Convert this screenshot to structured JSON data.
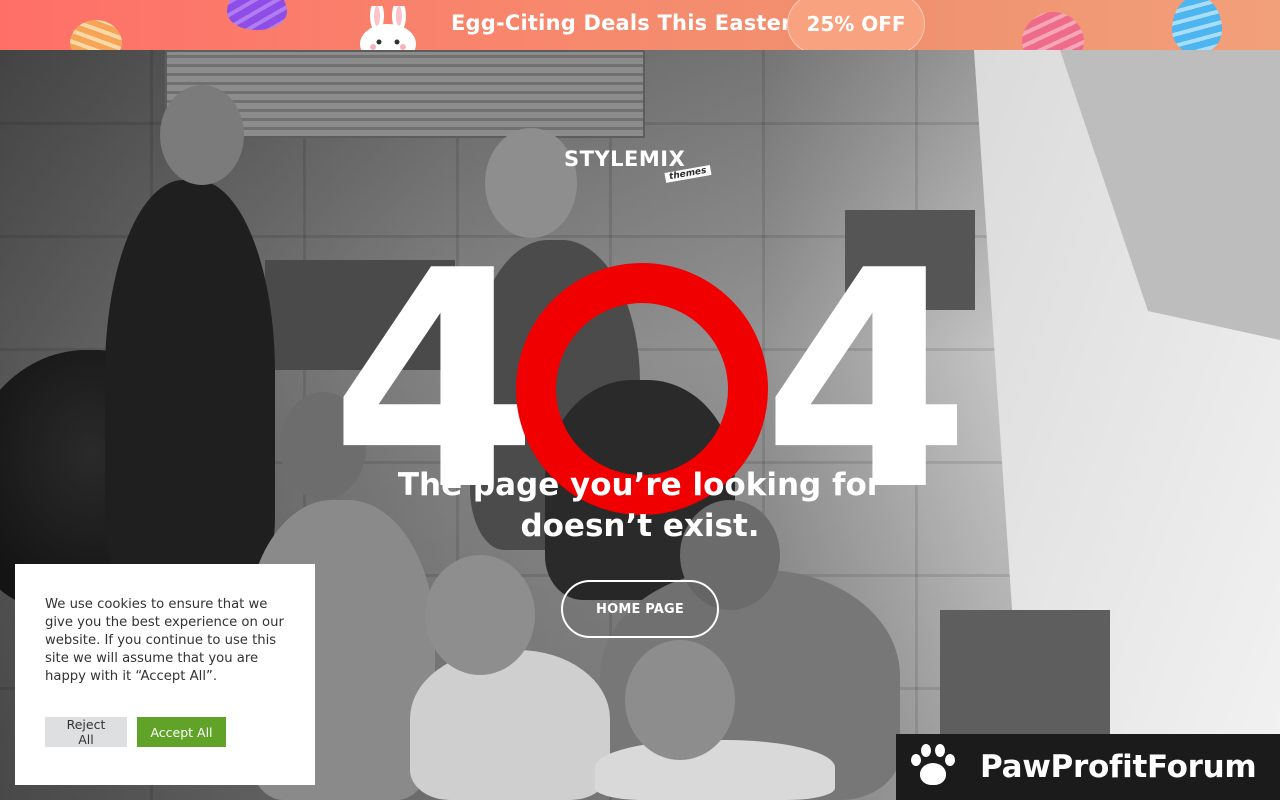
{
  "promo": {
    "headline": "Egg-Citing Deals This Easter",
    "discount": "25% OFF"
  },
  "logo": {
    "name": "STYLEMIX",
    "tagline": "themes"
  },
  "error": {
    "digit_left": "4",
    "digit_right": "4",
    "message_line1": "The page you’re looking for",
    "message_line2": "doesn’t exist.",
    "ring_color": "#f00000"
  },
  "home_button": {
    "label": "HOME PAGE"
  },
  "cookie_notice": {
    "text": "We use cookies to ensure that we give you the best experience on our website. If you continue to use this site we will assume that you are happy with it “Accept All”.",
    "reject_label": "Reject All",
    "accept_label": "Accept All",
    "accept_color": "#61a229"
  },
  "watermark": {
    "text": "PawProfitForum",
    "icon": "paw-icon"
  },
  "colors": {
    "banner_start": "#ff6f68",
    "banner_end": "#f2a07a"
  }
}
